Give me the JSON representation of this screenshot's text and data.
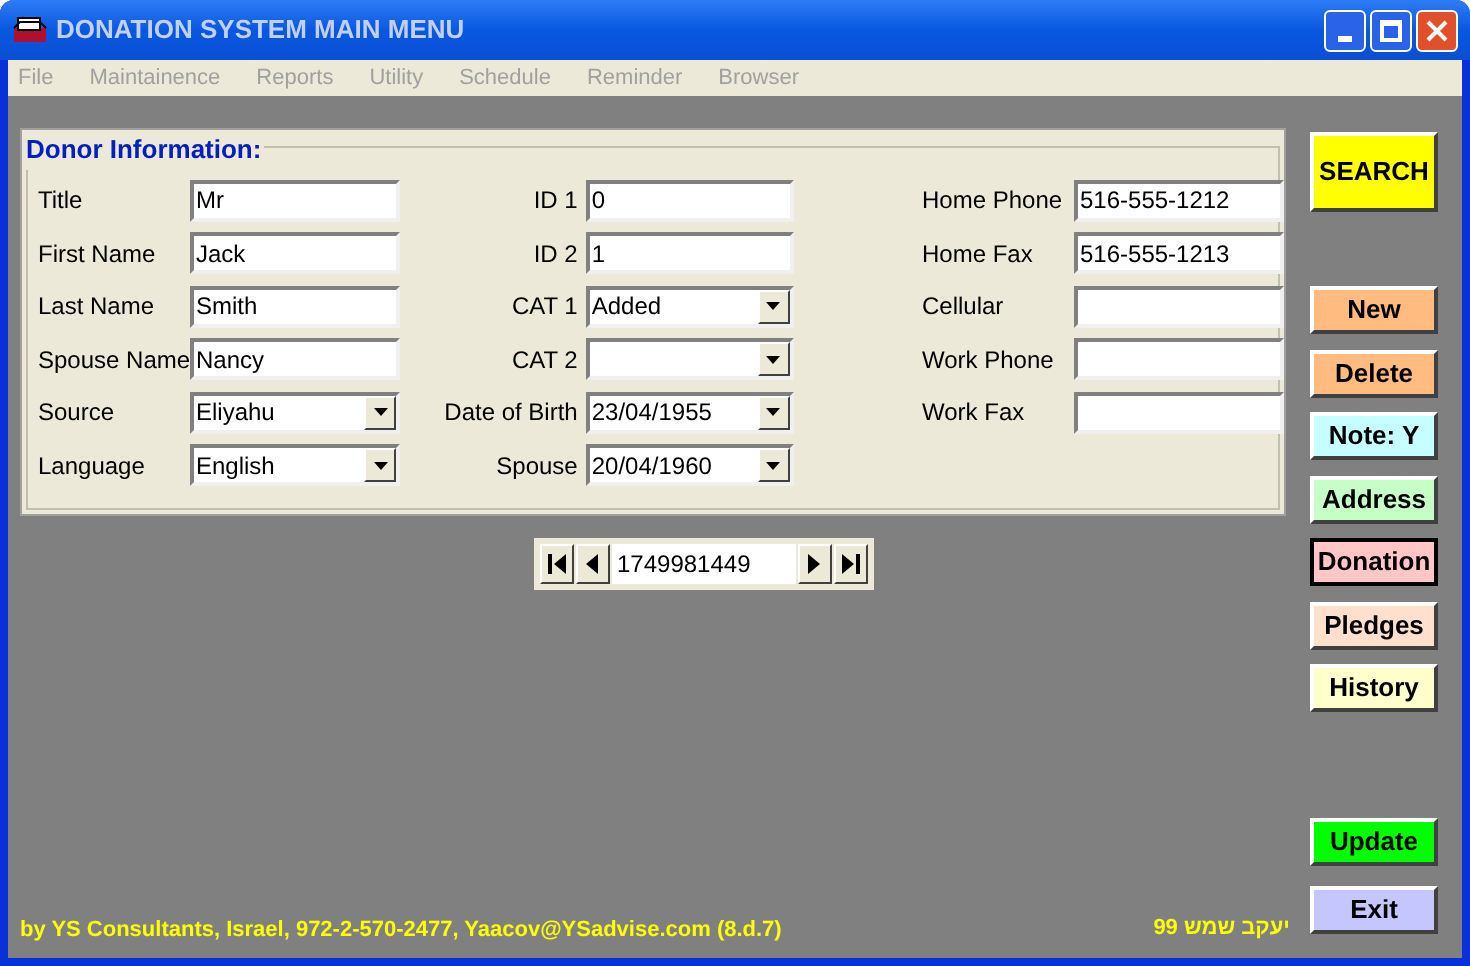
{
  "window": {
    "title": "DONATION SYSTEM MAIN MENU"
  },
  "menu": [
    {
      "label": "File",
      "disabled": true
    },
    {
      "label": "Maintainence",
      "disabled": true
    },
    {
      "label": "Reports",
      "disabled": true
    },
    {
      "label": "Utility",
      "disabled": true
    },
    {
      "label": "Schedule",
      "disabled": true
    },
    {
      "label": "Reminder",
      "disabled": true
    },
    {
      "label": "Browser",
      "disabled": true
    }
  ],
  "donor_info": {
    "title": "Donor Information:",
    "columns": [
      {
        "fields": [
          {
            "label": "Title",
            "value": "Mr",
            "kind": "text"
          },
          {
            "label": "First Name",
            "value": "Jack",
            "kind": "text"
          },
          {
            "label": "Last Name",
            "value": "Smith",
            "kind": "text"
          },
          {
            "label": "Spouse Name",
            "value": "Nancy",
            "kind": "text"
          },
          {
            "label": "Source",
            "value": "Eliyahu",
            "kind": "dropdown"
          },
          {
            "label": "Language",
            "value": "English",
            "kind": "dropdown"
          }
        ]
      },
      {
        "fields": [
          {
            "label": "ID 1",
            "value": "0",
            "kind": "text"
          },
          {
            "label": "ID 2",
            "value": "1",
            "kind": "text"
          },
          {
            "label": "CAT 1",
            "value": "Added",
            "kind": "dropdown"
          },
          {
            "label": "CAT 2",
            "kind": "dropdown"
          },
          {
            "label": "Date of Birth",
            "value": "23/04/1955",
            "kind": "dropdown"
          },
          {
            "label": "Spouse",
            "value": "20/04/1960",
            "kind": "dropdown"
          }
        ]
      },
      {
        "fields": [
          {
            "label": "Home Phone",
            "value": "516-555-1212",
            "kind": "text"
          },
          {
            "label": "Home Fax",
            "value": "516-555-1213",
            "kind": "text"
          },
          {
            "label": "Cellular",
            "kind": "text"
          },
          {
            "label": "Work Phone",
            "kind": "text"
          },
          {
            "label": "Work Fax",
            "kind": "text"
          }
        ]
      }
    ]
  },
  "navigator": {
    "record": "1749981449"
  },
  "search_button": {
    "label": "SEARCH",
    "color": "#ffff00"
  },
  "side_buttons": [
    {
      "label": "New",
      "color": "#ffbb80",
      "selected": false
    },
    {
      "label": "Delete",
      "color": "#ffbb80",
      "selected": false
    },
    {
      "label": "Note: Y",
      "color": "#c6ffff",
      "selected": false
    },
    {
      "label": "Address",
      "color": "#c6ffc6",
      "selected": false
    },
    {
      "label": "Donation",
      "color": "#ffc6c6",
      "selected": true
    },
    {
      "label": "Pledges",
      "color": "#ffe0cc",
      "selected": false
    },
    {
      "label": "History",
      "color": "#ffffcc",
      "selected": false
    }
  ],
  "bottom_buttons": [
    {
      "label": "Update",
      "color": "#00ff00"
    },
    {
      "label": "Exit",
      "color": "#c6c6ff"
    }
  ],
  "footer": {
    "credit": "by YS Consultants, Israel, 972-2-570-2477, Yaacov@YSadvise.com (8.d.7)",
    "hebrew": "יעקב שמש 99"
  }
}
